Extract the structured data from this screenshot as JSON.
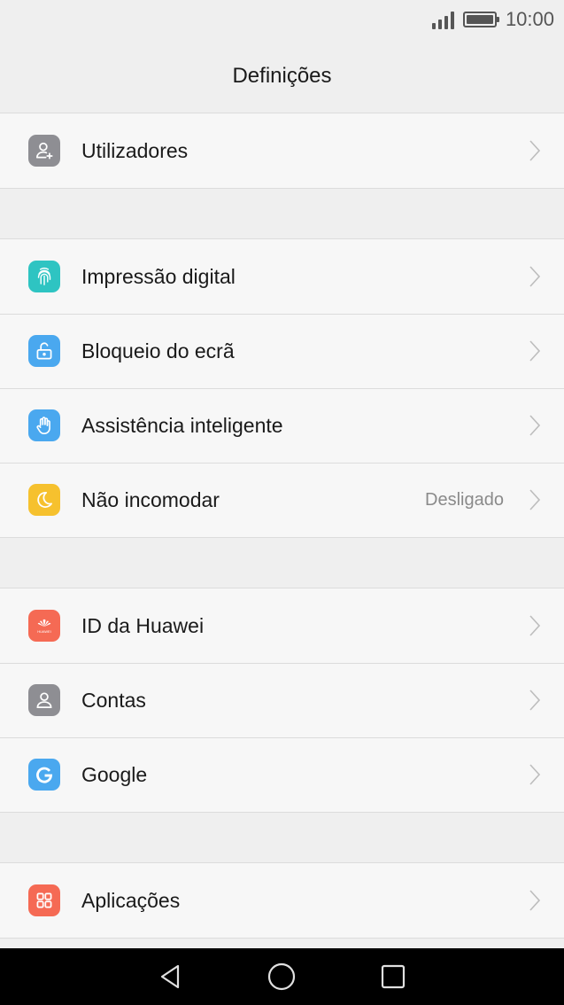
{
  "status": {
    "time": "10:00"
  },
  "header": {
    "title": "Definições"
  },
  "groups": [
    {
      "items": [
        {
          "label": "Utilizadores",
          "icon": "user-add-icon",
          "color": "#8e8e93"
        }
      ]
    },
    {
      "items": [
        {
          "label": "Impressão digital",
          "icon": "fingerprint-icon",
          "color": "#2ec4c2"
        },
        {
          "label": "Bloqueio do ecrã",
          "icon": "unlock-icon",
          "color": "#4aa8ef"
        },
        {
          "label": "Assistência inteligente",
          "icon": "hand-icon",
          "color": "#4aa8ef"
        },
        {
          "label": "Não incomodar",
          "icon": "moon-icon",
          "color": "#f6c12e",
          "value": "Desligado"
        }
      ]
    },
    {
      "items": [
        {
          "label": "ID da Huawei",
          "icon": "huawei-icon",
          "color": "#f56a54",
          "logo_text": "HUAWEI"
        },
        {
          "label": "Contas",
          "icon": "account-icon",
          "color": "#8e8e93"
        },
        {
          "label": "Google",
          "icon": "google-icon",
          "color": "#4aa8ef"
        }
      ]
    },
    {
      "items": [
        {
          "label": "Aplicações",
          "icon": "apps-grid-icon",
          "color": "#f56a54"
        }
      ]
    }
  ]
}
